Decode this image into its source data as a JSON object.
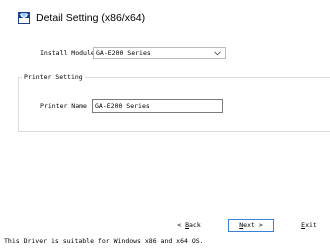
{
  "window": {
    "title": "Detail Setting (x86/x64)",
    "icon": "printer-settings-icon"
  },
  "install_module": {
    "label": "Install Module",
    "value": "GA-E200 Series"
  },
  "printer_setting": {
    "group_label": "Printer Setting",
    "printer_name_label": "Printer Name",
    "printer_name_value": "GA-E200 Series"
  },
  "buttons": {
    "back": {
      "arrow": "< ",
      "accel": "B",
      "rest": "ack"
    },
    "next": {
      "accel": "N",
      "rest": "ext",
      "arrow": " >"
    },
    "exit": {
      "accel": "E",
      "rest": "xit"
    }
  },
  "status": {
    "text": "This Driver is suitable for Windows x86 and x64 OS."
  },
  "colors": {
    "focus_border": "#3b7fd8",
    "group_border": "#dcdcdc"
  }
}
